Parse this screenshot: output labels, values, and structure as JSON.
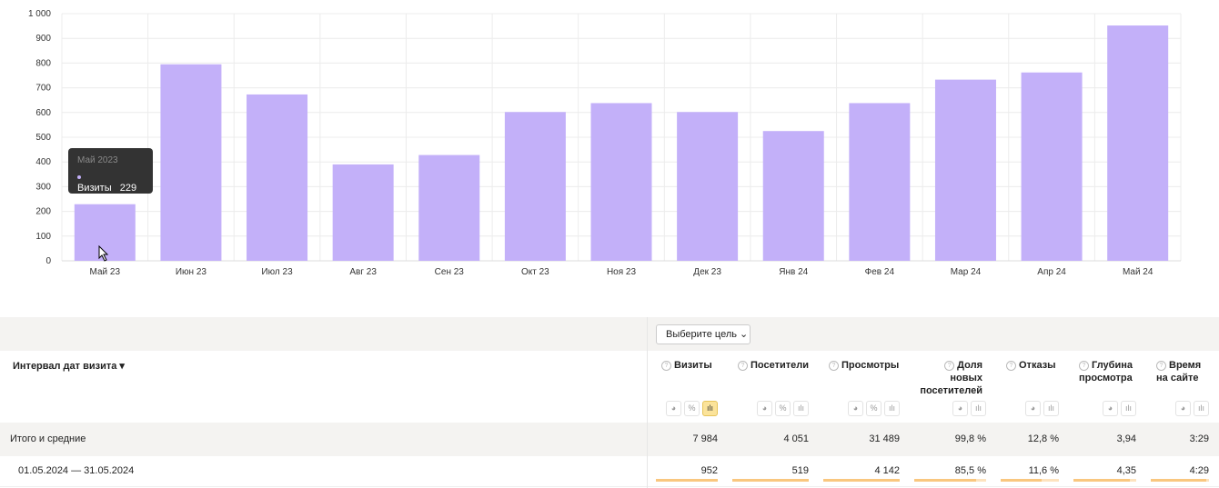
{
  "chart_data": {
    "type": "bar",
    "series_name": "Визиты",
    "categories": [
      "Май 23",
      "Июн 23",
      "Июл 23",
      "Авг 23",
      "Сен 23",
      "Окт 23",
      "Ноя 23",
      "Дек 23",
      "Янв 24",
      "Фев 24",
      "Мар 24",
      "Апр 24",
      "Май 24"
    ],
    "values": [
      229,
      795,
      673,
      390,
      428,
      602,
      638,
      602,
      525,
      638,
      733,
      762,
      952
    ],
    "yticks": [
      "0",
      "100",
      "200",
      "300",
      "400",
      "500",
      "600",
      "700",
      "800",
      "900",
      "1 000"
    ],
    "ylim": [
      0,
      1000
    ],
    "grid": true,
    "bar_color": "#c3b0f9"
  },
  "tooltip": {
    "title": "Май 2023",
    "series": "Визиты",
    "value": "229"
  },
  "goal_button": "Выберите цель",
  "table": {
    "dimension_header": "Интервал дат визита ▾",
    "columns": [
      {
        "label": "Визиты",
        "icons": [
          "pie",
          "%",
          "bars"
        ],
        "active": "bars",
        "total": "7 984",
        "value": "952",
        "fill": 1.0
      },
      {
        "label": "Посетители",
        "icons": [
          "pie",
          "%",
          "bars"
        ],
        "total": "4 051",
        "value": "519",
        "fill": 1.0
      },
      {
        "label": "Просмотры",
        "icons": [
          "pie",
          "%",
          "bars"
        ],
        "total": "31 489",
        "value": "4 142",
        "fill": 1.0
      },
      {
        "label": "Доля новых посетителей",
        "icons": [
          "pie",
          "bars"
        ],
        "total": "99,8 %",
        "value": "85,5 %",
        "fill": 0.86
      },
      {
        "label": "Отказы",
        "icons": [
          "pie",
          "bars"
        ],
        "total": "12,8 %",
        "value": "11,6 %",
        "fill": 0.7
      },
      {
        "label": "Глубина просмотра",
        "icons": [
          "pie",
          "bars"
        ],
        "total": "3,94",
        "value": "4,35",
        "fill": 0.9
      },
      {
        "label": "Время на сайте",
        "icons": [
          "pie",
          "bars"
        ],
        "total": "3:29",
        "value": "4:29",
        "fill": 0.95
      }
    ],
    "total_label": "Итого и средние",
    "row_label": "01.05.2024 — 31.05.2024"
  }
}
